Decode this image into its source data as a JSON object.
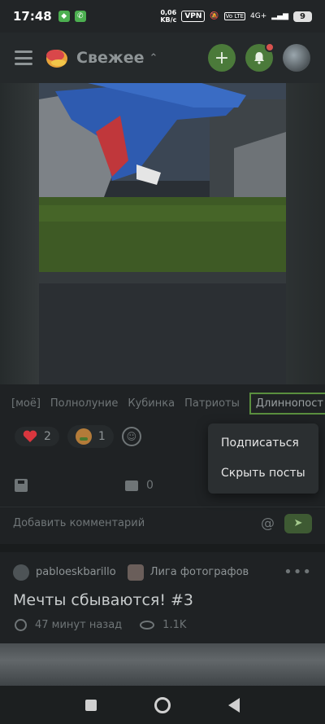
{
  "status_bar": {
    "time": "17:48",
    "network_speed_top": "0,06",
    "network_speed_bottom": "KB/c",
    "vpn": "VPN",
    "lte": "Vo LTE",
    "signal": "4G+",
    "battery": "9"
  },
  "header": {
    "feed_title": "Свежее"
  },
  "post": {
    "tags": [
      "[моё]",
      "Полнолуние",
      "Кубинка",
      "Патриоты",
      "Длиннопост"
    ],
    "active_tag": "Длиннопост",
    "reactions": [
      {
        "icon": "heart-icon",
        "count": "2"
      },
      {
        "icon": "sick-face-icon",
        "count": "1"
      }
    ],
    "comment_count": "0",
    "comment_placeholder": "Добавить комментарий"
  },
  "tag_menu": {
    "items": [
      "Подписаться",
      "Скрыть посты"
    ]
  },
  "next_post": {
    "author": "pabloeskbarillo",
    "community": "Лига фотографов",
    "title": "Мечты сбываются! #3",
    "time_ago": "47 минут назад",
    "views": "1.1K"
  },
  "colors": {
    "accent_green": "#5a8f3f",
    "heart_red": "#d9363e",
    "background": "#1f2224"
  }
}
